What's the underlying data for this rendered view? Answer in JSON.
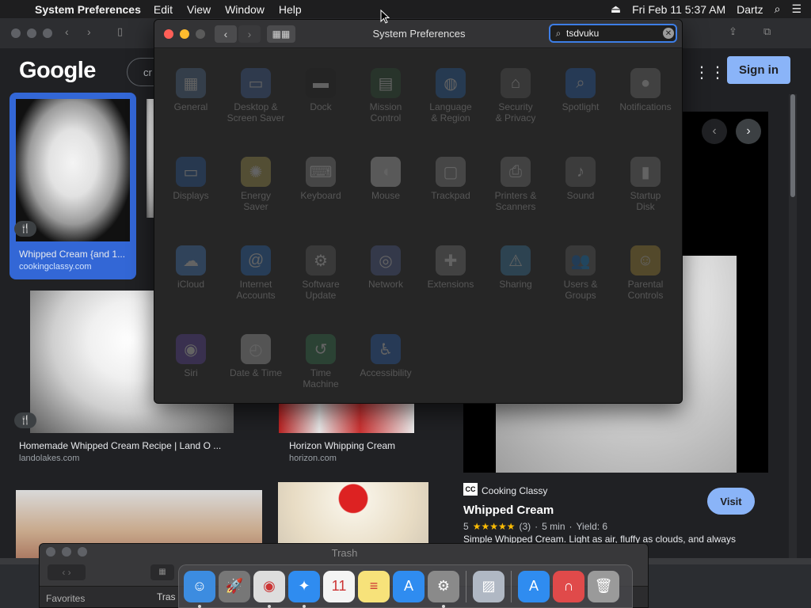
{
  "menubar": {
    "app_name": "System Preferences",
    "items": [
      "Edit",
      "View",
      "Window",
      "Help"
    ],
    "datetime": "Fri Feb 11  5:37 AM",
    "user": "Dartz"
  },
  "browser": {
    "logo": "Google",
    "search_partial": "cr",
    "signin_label": "Sign in",
    "results": [
      {
        "title": "Whipped Cream {and 1...",
        "source": "cookingclassy.com"
      },
      {
        "title": "Homemade Whipped Cream Recipe | Land O ...",
        "source": "landolakes.com"
      },
      {
        "title": "Horizon Whipping Cream",
        "source": "horizon.com"
      }
    ],
    "preview": {
      "site": "Cooking Classy",
      "site_abbr": "CC",
      "title": "Whipped Cream",
      "rating": "5",
      "stars": "★★★★★",
      "reviews": "(3)",
      "time": "5 min",
      "yield": "Yield: 6",
      "snippet": "Simple Whipped Cream. Light as air, fluffy as clouds, and always",
      "visit_label": "Visit"
    }
  },
  "syspref": {
    "title": "System Preferences",
    "search_value": "tsdvuku",
    "panes": [
      {
        "label": "General",
        "icon": "general-icon",
        "color": "#5b7fa8",
        "glyph": "▦"
      },
      {
        "label": "Desktop &\nScreen Saver",
        "icon": "desktop-icon",
        "color": "#4a6fb5",
        "glyph": "▭"
      },
      {
        "label": "Dock",
        "icon": "dock-icon",
        "color": "#222222",
        "glyph": "▬"
      },
      {
        "label": "Mission\nControl",
        "icon": "mission-control-icon",
        "color": "#2f5a3a",
        "glyph": "▤"
      },
      {
        "label": "Language\n& Region",
        "icon": "globe-icon",
        "color": "#2a6fc1",
        "glyph": "◍"
      },
      {
        "label": "Security\n& Privacy",
        "icon": "house-lock-icon",
        "color": "#6a6a6a",
        "glyph": "⌂"
      },
      {
        "label": "Spotlight",
        "icon": "spotlight-icon",
        "color": "#2a6fd1",
        "glyph": "⌕"
      },
      {
        "label": "Notifications",
        "icon": "notifications-icon",
        "color": "#8a8a8a",
        "glyph": "●"
      },
      {
        "label": "Displays",
        "icon": "display-icon",
        "color": "#2c66b8",
        "glyph": "▭"
      },
      {
        "label": "Energy\nSaver",
        "icon": "lightbulb-icon",
        "color": "#c9b65a",
        "glyph": "✺"
      },
      {
        "label": "Keyboard",
        "icon": "keyboard-icon",
        "color": "#9a9a9a",
        "glyph": "⌨"
      },
      {
        "label": "Mouse",
        "icon": "mouse-icon",
        "color": "#dddddd",
        "glyph": "◖"
      },
      {
        "label": "Trackpad",
        "icon": "trackpad-icon",
        "color": "#9a9a9a",
        "glyph": "▢"
      },
      {
        "label": "Printers &\nScanners",
        "icon": "printer-icon",
        "color": "#8a8a8a",
        "glyph": "⎙"
      },
      {
        "label": "Sound",
        "icon": "speaker-icon",
        "color": "#777777",
        "glyph": "♪"
      },
      {
        "label": "Startup\nDisk",
        "icon": "disk-icon",
        "color": "#8a8a8a",
        "glyph": "▮"
      },
      {
        "label": "iCloud",
        "icon": "cloud-icon",
        "color": "#4a90e2",
        "glyph": "☁"
      },
      {
        "label": "Internet\nAccounts",
        "icon": "at-icon",
        "color": "#2a7ad6",
        "glyph": "@"
      },
      {
        "label": "Software\nUpdate",
        "icon": "gear-icon",
        "color": "#6a6a6a",
        "glyph": "⚙"
      },
      {
        "label": "Network",
        "icon": "network-icon",
        "color": "#5a6aa8",
        "glyph": "◎"
      },
      {
        "label": "Extensions",
        "icon": "puzzle-icon",
        "color": "#8a8a8a",
        "glyph": "✚"
      },
      {
        "label": "Sharing",
        "icon": "sharing-folder-icon",
        "color": "#3f8fbf",
        "glyph": "⚠"
      },
      {
        "label": "Users &\nGroups",
        "icon": "users-icon",
        "color": "#6a6a6a",
        "glyph": "👥"
      },
      {
        "label": "Parental\nControls",
        "icon": "parental-icon",
        "color": "#c9a53a",
        "glyph": "☺"
      },
      {
        "label": "Siri",
        "icon": "siri-icon",
        "color": "#6a4ab8",
        "glyph": "◉"
      },
      {
        "label": "Date & Time",
        "icon": "clock-icon",
        "color": "#cccccc",
        "glyph": "◴"
      },
      {
        "label": "Time\nMachine",
        "icon": "time-machine-icon",
        "color": "#3a8a5a",
        "glyph": "↺"
      },
      {
        "label": "Accessibility",
        "icon": "accessibility-icon",
        "color": "#2a6fd1",
        "glyph": "♿"
      }
    ]
  },
  "finder": {
    "title": "Trash",
    "sidebar_header": "Favorites",
    "column_label": "Tras"
  },
  "dock": {
    "apps": [
      {
        "name": "finder-icon",
        "color": "#3c8ce0",
        "glyph": "☺",
        "running": true
      },
      {
        "name": "launchpad-icon",
        "color": "#777777",
        "glyph": "🚀",
        "running": false
      },
      {
        "name": "chrome-icon",
        "color": "#dddddd",
        "glyph": "◉",
        "running": true
      },
      {
        "name": "safari-icon",
        "color": "#2f8cf0",
        "glyph": "✦",
        "running": true
      },
      {
        "name": "calendar-icon",
        "color": "#f4f4f4",
        "glyph": "11",
        "running": false
      },
      {
        "name": "notes-icon",
        "color": "#f7e27a",
        "glyph": "≡",
        "running": false
      },
      {
        "name": "app-store-icon",
        "color": "#2f8cf0",
        "glyph": "A",
        "running": false
      },
      {
        "name": "system-preferences-icon",
        "color": "#8a8a8a",
        "glyph": "⚙",
        "running": true
      },
      {
        "name": "preview-icon",
        "color": "#b0b8c4",
        "glyph": "▨",
        "running": false
      },
      {
        "name": "app-store-download-icon",
        "color": "#2f8cf0",
        "glyph": "A",
        "running": false
      },
      {
        "name": "magnet-icon",
        "color": "#e04a4a",
        "glyph": "∩",
        "running": false
      },
      {
        "name": "trash-icon",
        "color": "#9a9a9a",
        "glyph": "🗑",
        "running": false
      }
    ]
  }
}
